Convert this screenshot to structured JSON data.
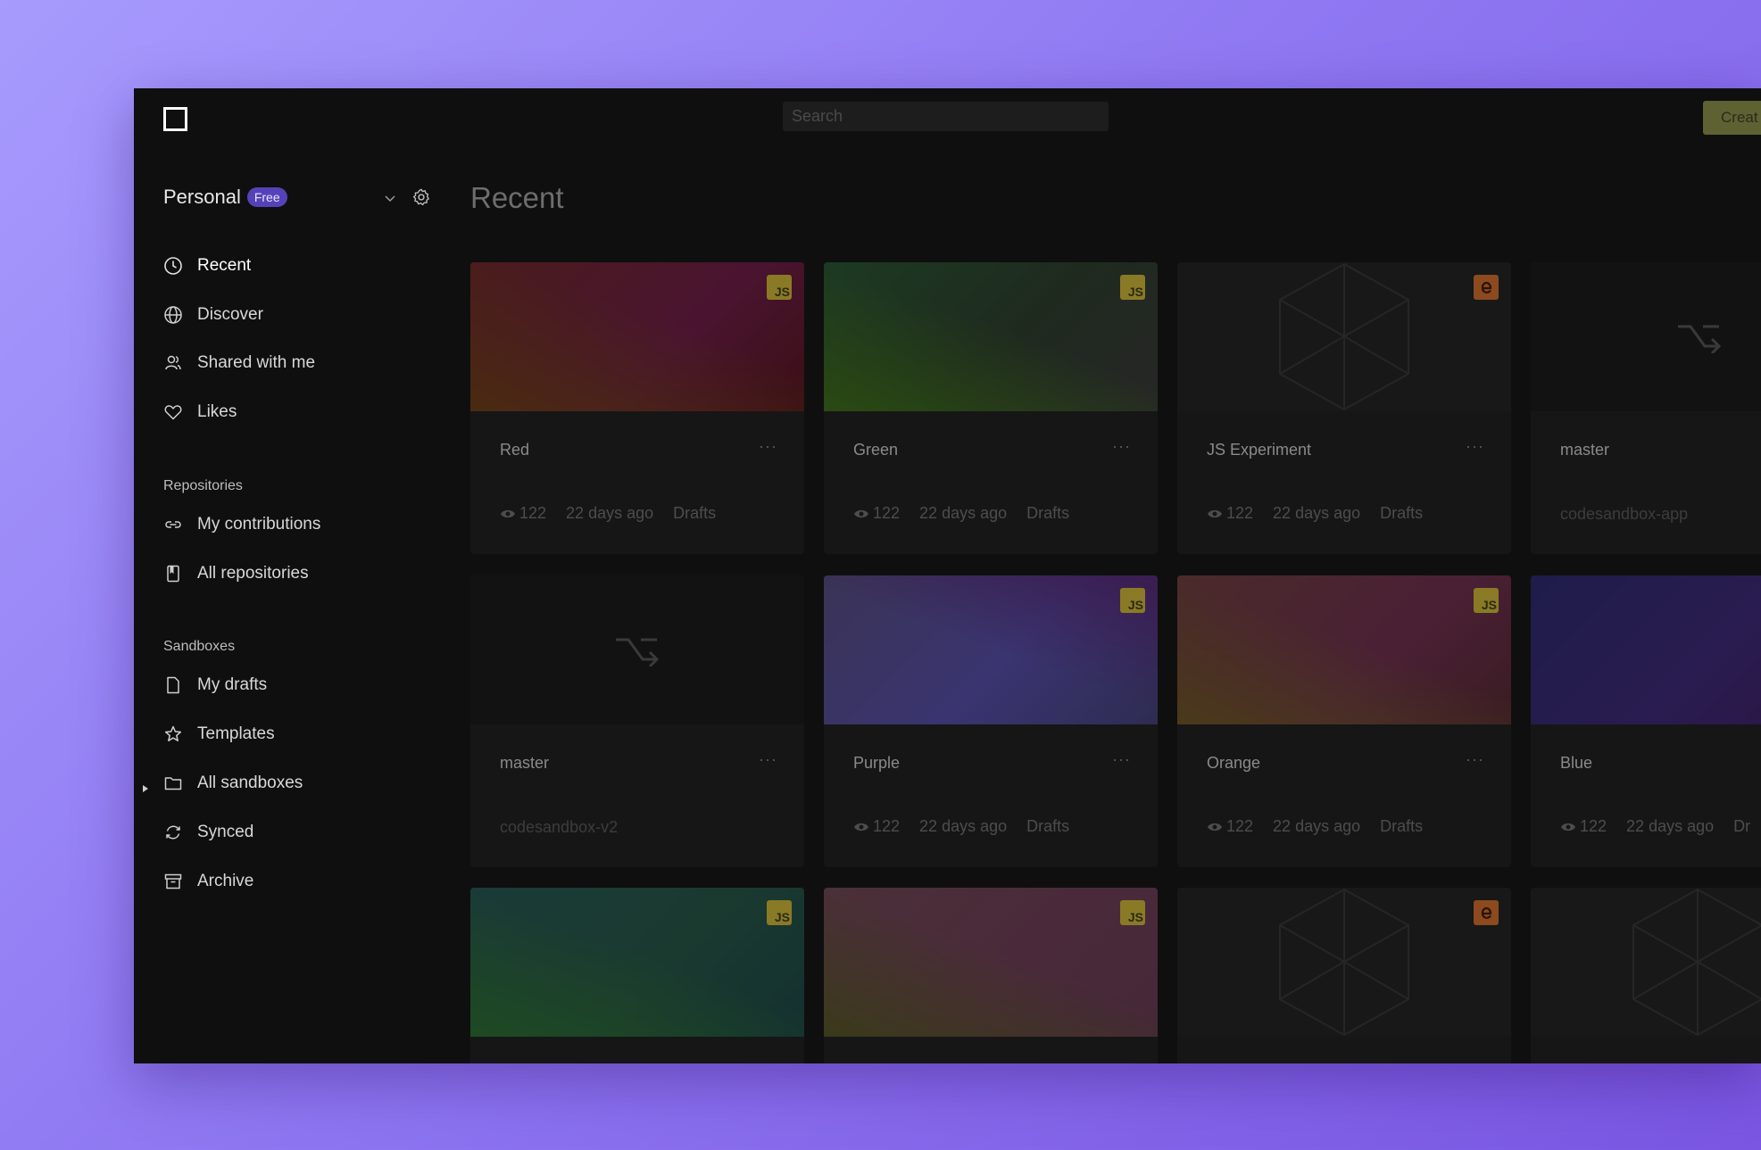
{
  "topbar": {
    "search_placeholder": "Search",
    "create_label": "Creat"
  },
  "workspace": {
    "name": "Personal",
    "badge": "Free"
  },
  "nav": {
    "recent": "Recent",
    "discover": "Discover",
    "shared": "Shared with me",
    "likes": "Likes"
  },
  "repositories": {
    "label": "Repositories",
    "my_contributions": "My contributions",
    "all_repositories": "All repositories"
  },
  "sandboxes": {
    "label": "Sandboxes",
    "my_drafts": "My drafts",
    "templates": "Templates",
    "all_sandboxes": "All sandboxes",
    "synced": "Synced",
    "archive": "Archive"
  },
  "main": {
    "title": "Recent"
  },
  "cards": [
    {
      "title": "Red",
      "views": "122",
      "time": "22 days ago",
      "folder": "Drafts"
    },
    {
      "title": "Green",
      "views": "122",
      "time": "22 days ago",
      "folder": "Drafts"
    },
    {
      "title": "JS Experiment",
      "views": "122",
      "time": "22 days ago",
      "folder": "Drafts"
    },
    {
      "title": "master",
      "repo": "codesandbox-app"
    },
    {
      "title": "master",
      "repo": "codesandbox-v2"
    },
    {
      "title": "Purple",
      "views": "122",
      "time": "22 days ago",
      "folder": "Drafts"
    },
    {
      "title": "Orange",
      "views": "122",
      "time": "22 days ago",
      "folder": "Drafts"
    },
    {
      "title": "Blue",
      "views": "122",
      "time": "22 days ago",
      "folder": "Dr"
    }
  ],
  "badges": {
    "js": "JS"
  },
  "icons": {
    "menu_dots": "···"
  },
  "colors": {
    "background_gradient_start": "#a79bfd",
    "background_gradient_end": "#7a56e2",
    "window_bg": "#0f0f0f",
    "free_badge": "#5542b8",
    "js_badge": "#8a7a25"
  }
}
